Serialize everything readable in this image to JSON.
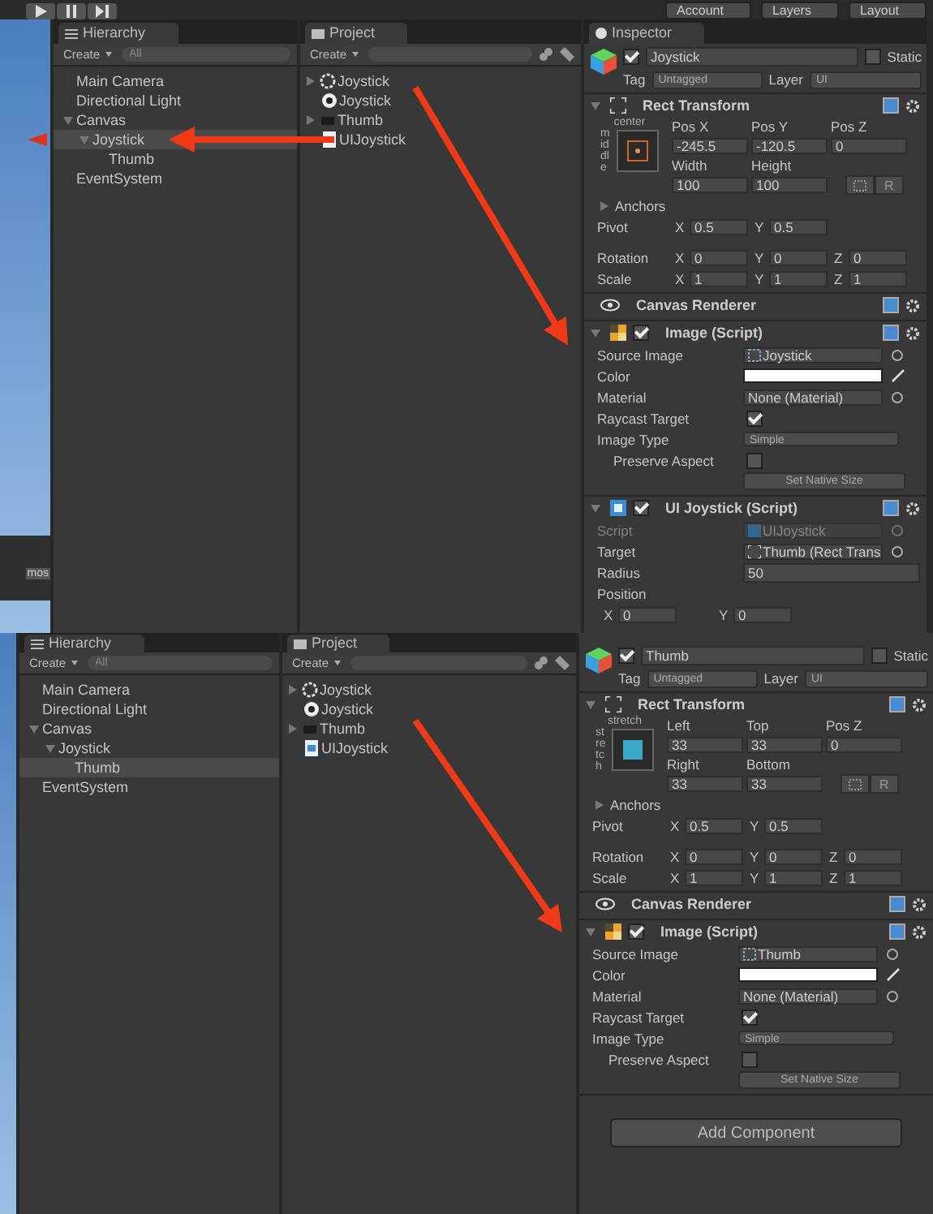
{
  "toolbar": {
    "menus": [
      "Account",
      "Layers",
      "Layout"
    ]
  },
  "screens": [
    {
      "scene": {
        "button": "mos"
      },
      "hierarchy": {
        "title": "Hierarchy",
        "create": "Create",
        "search_placeholder": "All",
        "items": [
          {
            "label": "Main Camera",
            "selected": false
          },
          {
            "label": "Directional Light",
            "selected": false
          },
          {
            "label": "Canvas",
            "selected": false,
            "expanded": true,
            "children": [
              {
                "label": "Joystick",
                "selected": true,
                "expanded": true,
                "children": [
                  {
                    "label": "Thumb",
                    "selected": false
                  }
                ]
              }
            ]
          },
          {
            "label": "EventSystem",
            "selected": false
          }
        ]
      },
      "project": {
        "title": "Project",
        "create": "Create",
        "items": [
          {
            "label": "Joystick",
            "kind": "ring",
            "expandable": true
          },
          {
            "label": "Joystick",
            "kind": "unity",
            "expandable": false
          },
          {
            "label": "Thumb",
            "kind": "dark",
            "expandable": true
          },
          {
            "label": "UIJoystick",
            "kind": "script",
            "expandable": false
          }
        ]
      },
      "inspector": {
        "title": "Inspector",
        "object": "Joystick",
        "active": true,
        "static": false,
        "static_label": "Static",
        "tag_label": "Tag",
        "tag": "Untagged",
        "layer_label": "Layer",
        "layer": "UI",
        "components": [
          {
            "kind": "rect_transform",
            "title": "Rect Transform",
            "anchor_h": "center",
            "anchor_v": "middle",
            "grid": [
              [
                {
                  "label": "Pos X",
                  "value": "-245.5"
                },
                {
                  "label": "Pos Y",
                  "value": "-120.5"
                },
                {
                  "label": "Pos Z",
                  "value": "0"
                }
              ],
              [
                {
                  "label": "Width",
                  "value": "100"
                },
                {
                  "label": "Height",
                  "value": "100"
                }
              ]
            ],
            "r_button": "R",
            "anchors": "Anchors",
            "vectors": [
              {
                "label": "Pivot",
                "axes": [
                  {
                    "axis": "X",
                    "value": "0.5"
                  },
                  {
                    "axis": "Y",
                    "value": "0.5"
                  }
                ]
              },
              {
                "label": "Rotation",
                "axes": [
                  {
                    "axis": "X",
                    "value": "0"
                  },
                  {
                    "axis": "Y",
                    "value": "0"
                  },
                  {
                    "axis": "Z",
                    "value": "0"
                  }
                ]
              },
              {
                "label": "Scale",
                "axes": [
                  {
                    "axis": "X",
                    "value": "1"
                  },
                  {
                    "axis": "Y",
                    "value": "1"
                  },
                  {
                    "axis": "Z",
                    "value": "1"
                  }
                ]
              }
            ]
          },
          {
            "kind": "canvas_renderer",
            "title": "Canvas Renderer"
          },
          {
            "kind": "image",
            "title": "Image (Script)",
            "enabled": true,
            "fields": [
              {
                "kind": "sprite_field",
                "label": "Source Image",
                "value": "Joystick"
              },
              {
                "kind": "color",
                "label": "Color"
              },
              {
                "kind": "object",
                "label": "Material",
                "value": "None (Material)"
              },
              {
                "kind": "check",
                "label": "Raycast Target",
                "checked": true
              },
              {
                "kind": "dropdown",
                "label": "Image Type",
                "value": "Simple"
              },
              {
                "kind": "check",
                "label": "Preserve Aspect",
                "checked": false,
                "indent": true
              },
              {
                "kind": "button",
                "label": "Set Native Size"
              }
            ]
          },
          {
            "kind": "script",
            "title": "UI Joystick (Script)",
            "enabled": true,
            "fields": [
              {
                "kind": "script_field",
                "label": "Script",
                "value": "UIJoystick",
                "disabled": true
              },
              {
                "kind": "transform_field",
                "label": "Target",
                "value": "Thumb (Rect Trans"
              },
              {
                "kind": "text",
                "label": "Radius",
                "value": "50"
              },
              {
                "kind": "heading",
                "label": "Position"
              },
              {
                "kind": "vector",
                "axes": [
                  {
                    "axis": "X",
                    "value": "0"
                  },
                  {
                    "axis": "Y",
                    "value": "0"
                  }
                ]
              }
            ]
          }
        ]
      }
    },
    {
      "hierarchy": {
        "title": "Hierarchy",
        "create": "Create",
        "search_placeholder": "All",
        "items": [
          {
            "label": "Main Camera",
            "selected": false
          },
          {
            "label": "Directional Light",
            "selected": false
          },
          {
            "label": "Canvas",
            "selected": false,
            "expanded": true,
            "children": [
              {
                "label": "Joystick",
                "selected": false,
                "expanded": true,
                "children": [
                  {
                    "label": "Thumb",
                    "selected": true
                  }
                ]
              }
            ]
          },
          {
            "label": "EventSystem",
            "selected": false
          }
        ]
      },
      "project": {
        "title": "Project",
        "create": "Create",
        "items": [
          {
            "label": "Joystick",
            "kind": "ring",
            "expandable": true
          },
          {
            "label": "Joystick",
            "kind": "unity",
            "expandable": false
          },
          {
            "label": "Thumb",
            "kind": "dark",
            "expandable": true
          },
          {
            "label": "UIJoystick",
            "kind": "script",
            "expandable": false
          }
        ]
      },
      "inspector": {
        "object": "Thumb",
        "active": true,
        "static": false,
        "static_label": "Static",
        "tag_label": "Tag",
        "tag": "Untagged",
        "layer_label": "Layer",
        "layer": "UI",
        "components": [
          {
            "kind": "rect_transform",
            "title": "Rect Transform",
            "anchor_h": "stretch",
            "anchor_v": "stretch",
            "grid": [
              [
                {
                  "label": "Left",
                  "value": "33"
                },
                {
                  "label": "Top",
                  "value": "33"
                },
                {
                  "label": "Pos Z",
                  "value": "0"
                }
              ],
              [
                {
                  "label": "Right",
                  "value": "33"
                },
                {
                  "label": "Bottom",
                  "value": "33"
                }
              ]
            ],
            "r_button": "R",
            "anchors": "Anchors",
            "vectors": [
              {
                "label": "Pivot",
                "axes": [
                  {
                    "axis": "X",
                    "value": "0.5"
                  },
                  {
                    "axis": "Y",
                    "value": "0.5"
                  }
                ]
              },
              {
                "label": "Rotation",
                "axes": [
                  {
                    "axis": "X",
                    "value": "0"
                  },
                  {
                    "axis": "Y",
                    "value": "0"
                  },
                  {
                    "axis": "Z",
                    "value": "0"
                  }
                ]
              },
              {
                "label": "Scale",
                "axes": [
                  {
                    "axis": "X",
                    "value": "1"
                  },
                  {
                    "axis": "Y",
                    "value": "1"
                  },
                  {
                    "axis": "Z",
                    "value": "1"
                  }
                ]
              }
            ]
          },
          {
            "kind": "canvas_renderer",
            "title": "Canvas Renderer"
          },
          {
            "kind": "image",
            "title": "Image (Script)",
            "enabled": true,
            "fields": [
              {
                "kind": "sprite_field",
                "label": "Source Image",
                "value": "Thumb"
              },
              {
                "kind": "color",
                "label": "Color"
              },
              {
                "kind": "object",
                "label": "Material",
                "value": "None (Material)"
              },
              {
                "kind": "check",
                "label": "Raycast Target",
                "checked": true
              },
              {
                "kind": "dropdown",
                "label": "Image Type",
                "value": "Simple"
              },
              {
                "kind": "check",
                "label": "Preserve Aspect",
                "checked": false,
                "indent": true
              },
              {
                "kind": "button",
                "label": "Set Native Size"
              }
            ]
          }
        ],
        "add_component": "Add Component"
      }
    }
  ]
}
